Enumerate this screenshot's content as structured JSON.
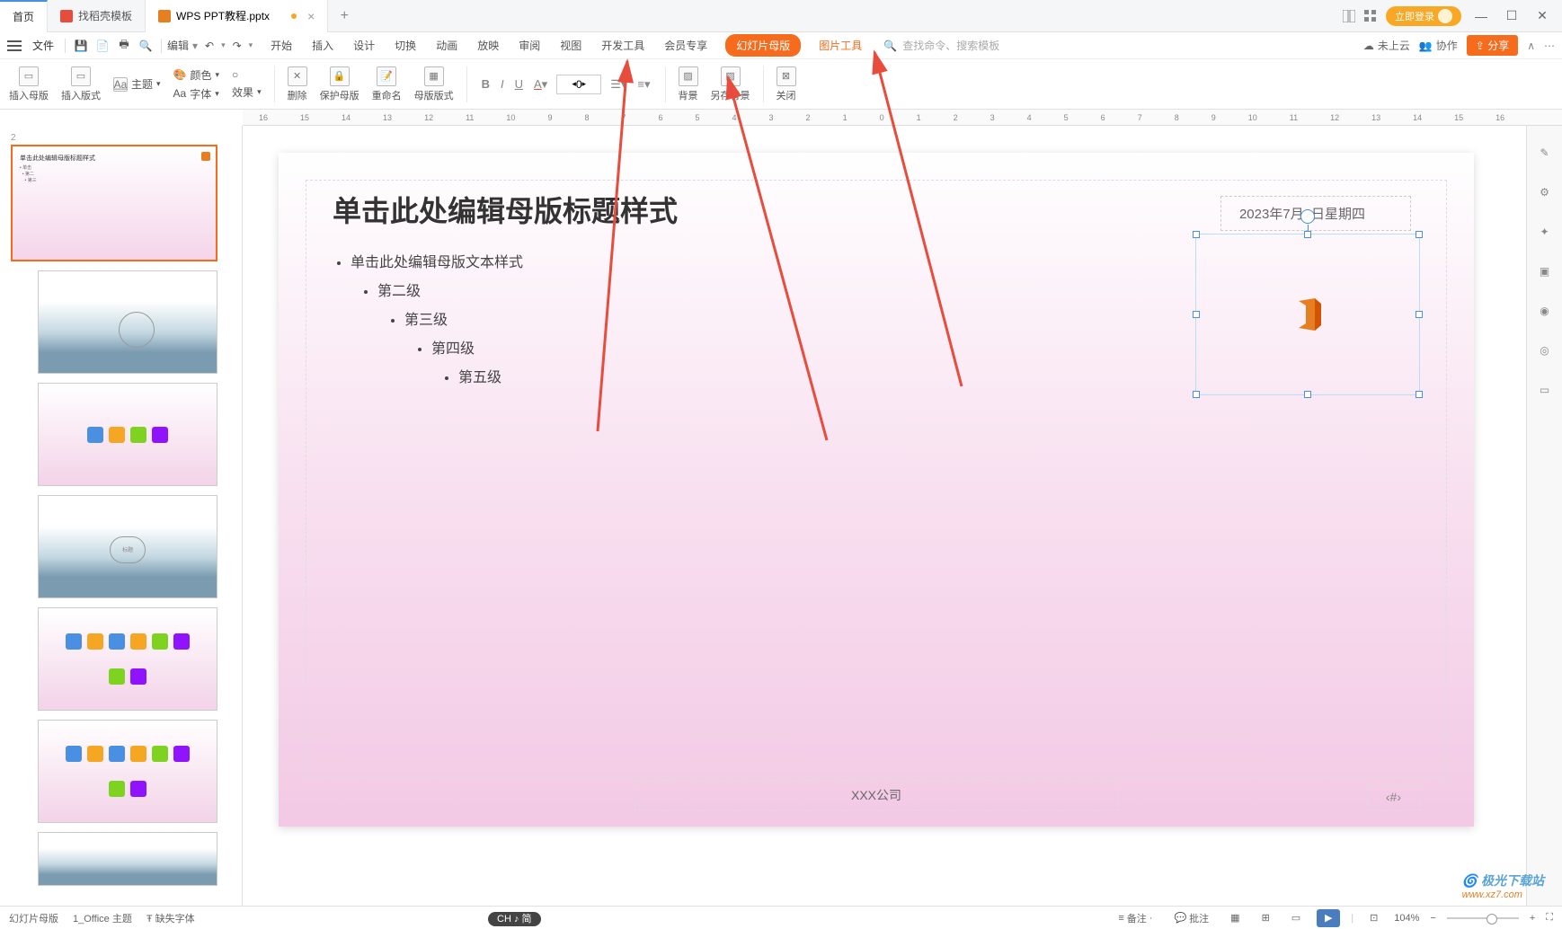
{
  "titlebar": {
    "home_tab": "首页",
    "docer_tab": "找稻壳模板",
    "doc_tab": "WPS PPT教程.pptx",
    "login": "立即登录"
  },
  "menubar": {
    "file": "文件",
    "edit": "编辑",
    "tabs": {
      "start": "开始",
      "insert": "插入",
      "design": "设计",
      "transition": "切换",
      "animation": "动画",
      "slideshow": "放映",
      "review": "审阅",
      "view": "视图",
      "dev": "开发工具",
      "vip": "会员专享",
      "master": "幻灯片母版",
      "pictools": "图片工具"
    },
    "search_placeholder": "查找命令、搜索模板",
    "cloud": "未上云",
    "collab": "协作",
    "share": "分享"
  },
  "ribbon": {
    "insert_master": "插入母版",
    "insert_layout": "插入版式",
    "theme": "主题",
    "color": "颜色",
    "font": "字体",
    "effect": "效果",
    "delete": "删除",
    "protect": "保护母版",
    "rename": "重命名",
    "master_layout": "母版版式",
    "font_num": "0",
    "background": "背景",
    "save_bg": "另存背景",
    "close": "关闭",
    "aa": "Aa"
  },
  "ruler_marks": [
    "16",
    "15",
    "14",
    "13",
    "12",
    "11",
    "10",
    "9",
    "8",
    "7",
    "6",
    "5",
    "4",
    "3",
    "2",
    "1",
    "0",
    "1",
    "2",
    "3",
    "4",
    "5",
    "6",
    "7",
    "8",
    "9",
    "10",
    "11",
    "12",
    "13",
    "14",
    "15",
    "16"
  ],
  "slide": {
    "num": "2",
    "title": "单击此处编辑母版标题样式",
    "body": "单击此处编辑母版文本样式",
    "l2": "第二级",
    "l3": "第三级",
    "l4": "第四级",
    "l5": "第五级",
    "date": "2023年7月6日星期四",
    "footer": "XXX公司",
    "number": "‹#›"
  },
  "status": {
    "master_view": "幻灯片母版",
    "theme": "1_Office 主题",
    "missing_font": "缺失字体",
    "ime": "CH ♪ 简",
    "notes": "备注",
    "comments": "批注",
    "zoom": "104%"
  },
  "watermark": {
    "brand": "极光下载站",
    "url": "www.xz7.com"
  }
}
